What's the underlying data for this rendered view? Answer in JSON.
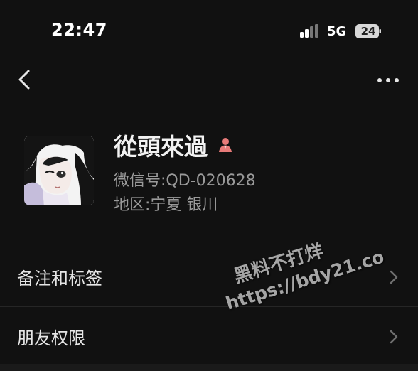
{
  "status_bar": {
    "time": "22:47",
    "network": "5G",
    "battery": "24"
  },
  "profile": {
    "name": "從頭來過",
    "wechat_id": "微信号:QD-020628",
    "region": "地区:宁夏 银川",
    "gender_icon": "female-user-icon"
  },
  "menu": {
    "items": [
      {
        "label": "备注和标签"
      },
      {
        "label": "朋友权限"
      }
    ]
  },
  "watermark": {
    "line1": "黑料不打烊",
    "line2": "https://bdy21.co"
  },
  "colors": {
    "background": "#111111",
    "primary_text": "#e9e9e9",
    "secondary_text": "#9a9a9a",
    "divider": "#262626",
    "gender_icon": "#e77b79"
  }
}
